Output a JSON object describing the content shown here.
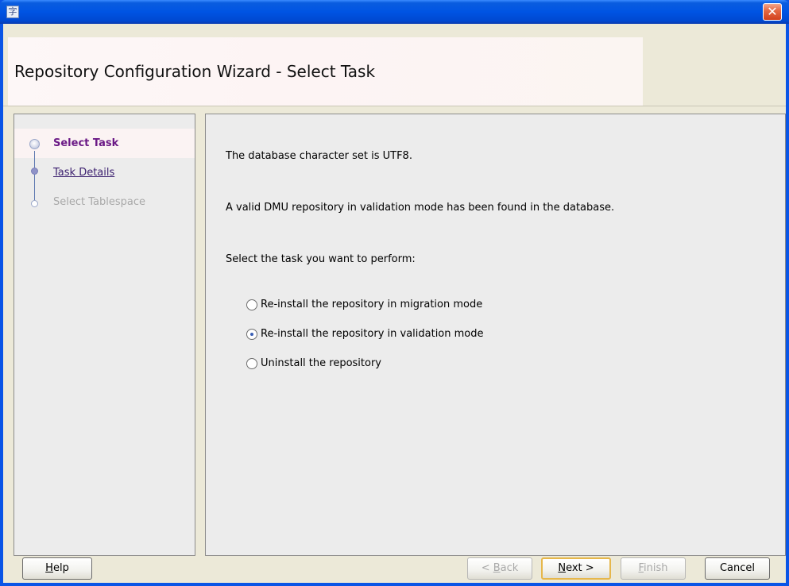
{
  "window": {
    "app_icon": "configuration-icon",
    "close_glyph": "✕",
    "app_icon_glyph": "字"
  },
  "header": {
    "title": "Repository Configuration Wizard - Select Task"
  },
  "steps": [
    {
      "label": "Select Task",
      "state": "current"
    },
    {
      "label": "Task Details",
      "state": "link"
    },
    {
      "label": "Select Tablespace",
      "state": "disabled"
    }
  ],
  "content": {
    "line1": "The database character set is UTF8.",
    "line2": "A valid DMU repository in validation mode has been found in the database.",
    "line3": "Select the task you want to perform:",
    "options": [
      {
        "label": "Re-install the repository in migration mode",
        "selected": false
      },
      {
        "label": "Re-install the repository in validation mode",
        "selected": true
      },
      {
        "label": "Uninstall the repository",
        "selected": false
      }
    ]
  },
  "buttons": {
    "help": {
      "mnemonic": "H",
      "rest": "elp"
    },
    "back": {
      "prefix": "< ",
      "mnemonic": "B",
      "rest": "ack"
    },
    "next": {
      "mnemonic": "N",
      "rest": "ext >"
    },
    "finish": {
      "mnemonic": "F",
      "rest": "inish"
    },
    "cancel": "Cancel"
  },
  "colors": {
    "titlebar": "#0054e3",
    "current_step": "#6b1a86",
    "default_button_border": "#e6b74b"
  }
}
